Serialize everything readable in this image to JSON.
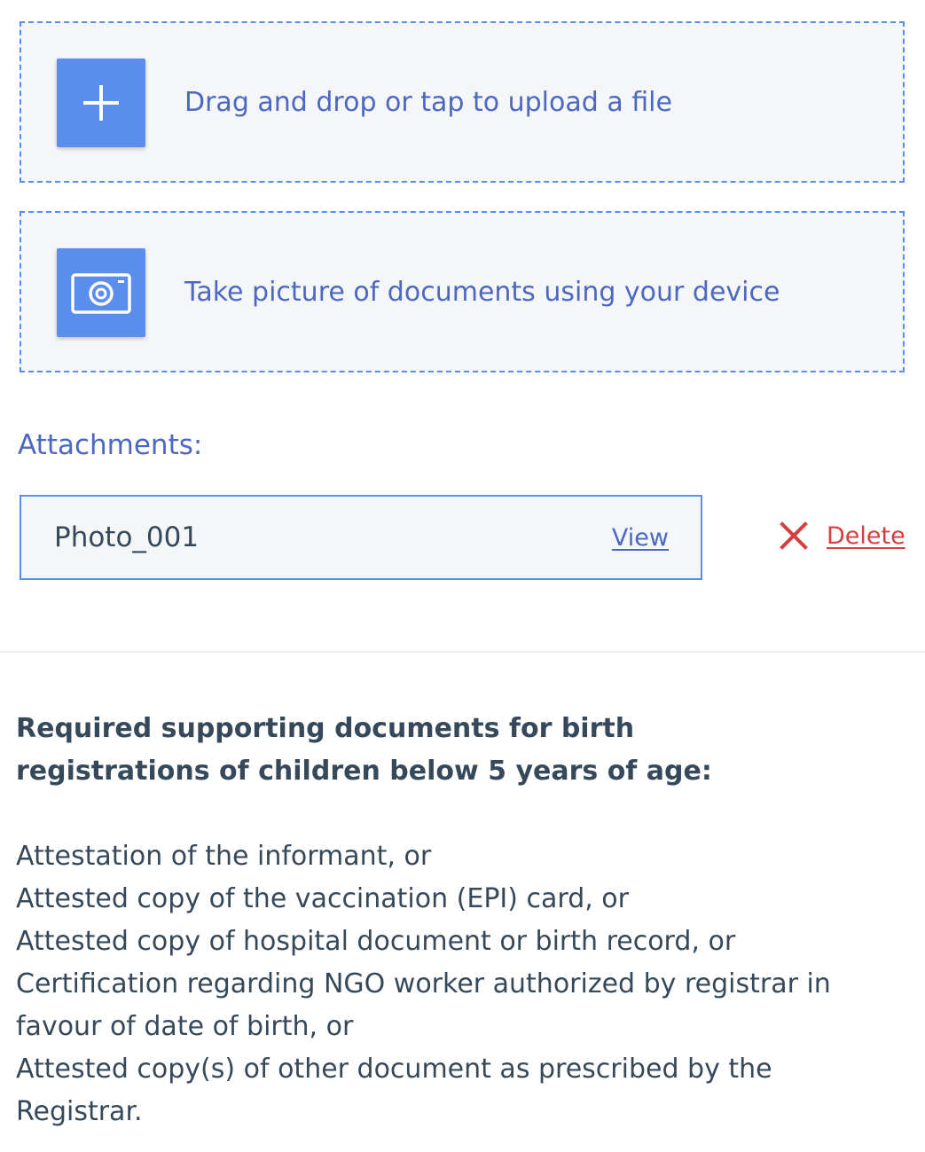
{
  "upload": {
    "file_label": "Drag and drop or tap to upload a file",
    "file_icon": "plus-icon",
    "camera_label": "Take picture of documents using your device",
    "camera_icon": "camera-icon"
  },
  "attachments": {
    "label": "Attachments:",
    "items": [
      {
        "name": "Photo_001",
        "view_label": "View",
        "delete_label": "Delete",
        "delete_icon": "close-icon"
      }
    ]
  },
  "requirements": {
    "heading": "Required supporting documents for birth registrations of children below 5 years of age:",
    "items": [
      "Attestation of the informant, or",
      "Attested copy of the vaccination (EPI) card, or",
      "Attested copy of hospital document or birth record, or",
      "Certification regarding NGO worker authorized by registrar in favour of date of birth, or",
      "Attested copy(s) of other document as prescribed by the Registrar."
    ]
  },
  "colors": {
    "accent": "#5b8def",
    "link": "#4c68c1",
    "danger": "#d53f3f",
    "text": "#35495b",
    "zone_background": "#f5f6f8"
  }
}
